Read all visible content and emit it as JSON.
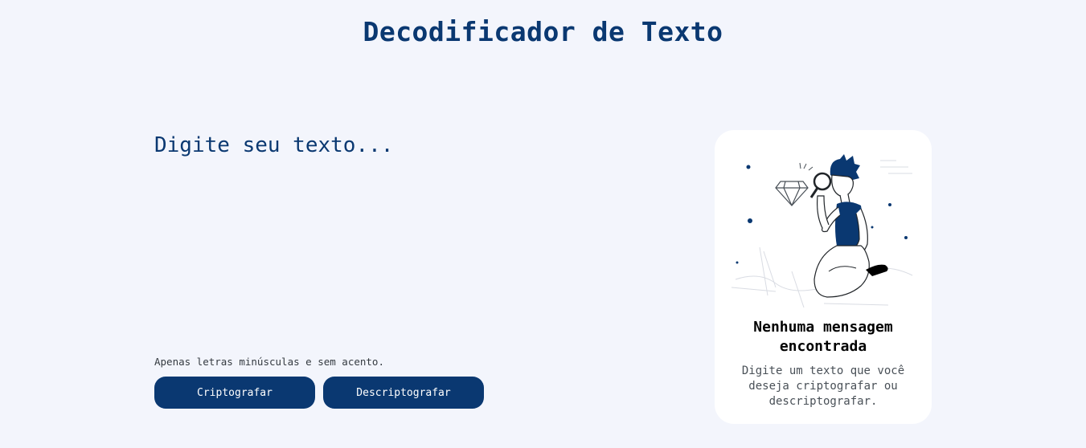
{
  "header": {
    "title": "Decodificador de Texto"
  },
  "editor": {
    "placeholder": "Digite seu texto..."
  },
  "hint": {
    "text": "Apenas letras minúsculas e sem acento."
  },
  "buttons": {
    "encrypt": "Criptografar",
    "decrypt": "Descriptografar"
  },
  "output": {
    "title": "Nenhuma mensagem encontrada",
    "text": "Digite um texto que você deseja criptografar ou descriptografar.",
    "illustration": "person-with-magnifier-illustration"
  },
  "colors": {
    "primary": "#0a3871",
    "background": "#f3f5fc",
    "card": "#ffffff"
  }
}
